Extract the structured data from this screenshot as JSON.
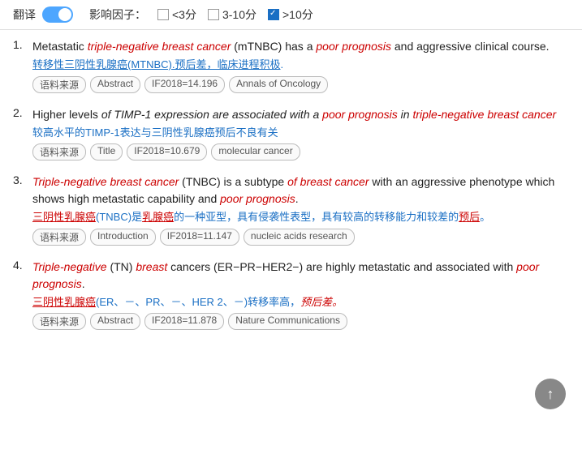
{
  "toolbar": {
    "translate_label": "翻译",
    "impact_label": "影响因子：",
    "filter_low_label": "<3分",
    "filter_mid_label": "3-10分",
    "filter_high_label": ">10分",
    "filter_high_checked": true
  },
  "results": [
    {
      "id": 1,
      "en_parts": [
        {
          "text": "Metastatic ",
          "style": ""
        },
        {
          "text": "triple-negative breast cancer",
          "style": "italic-red"
        },
        {
          "text": " (mTNBC) has a ",
          "style": ""
        },
        {
          "text": "poor prognosis",
          "style": "italic-red"
        },
        {
          "text": " and aggressive clinical course.",
          "style": ""
        }
      ],
      "cn_parts": [
        {
          "text": "转移性三阴性乳腺癌",
          "style": "underline-blue"
        },
        {
          "text": "(MTNBC)",
          "style": "underline-blue"
        },
        {
          "text": ".",
          "style": ""
        },
        {
          "text": "预后差，",
          "style": "underline-blue"
        },
        {
          "text": "临床进程积极",
          "style": "underline-blue"
        },
        {
          "text": ".",
          "style": ""
        }
      ],
      "tags": [
        "语料来源",
        "Abstract",
        "IF2018=14.196",
        "Annals of Oncology"
      ]
    },
    {
      "id": 2,
      "en_parts": [
        {
          "text": "Higher levels ",
          "style": ""
        },
        {
          "text": "of TIMP-1 expression are associated with a",
          "style": "italic"
        },
        {
          "text": " ",
          "style": ""
        },
        {
          "text": "poor prognosis",
          "style": "italic-red"
        },
        {
          "text": " in ",
          "style": "italic"
        },
        {
          "text": "triple-n",
          "style": "italic-red"
        },
        {
          "text": "egative breast cancer",
          "style": "italic-red"
        }
      ],
      "cn_parts": [
        {
          "text": "较高水平的TIMP-1表达与三阴性乳腺癌预后不良有关",
          "style": "blue"
        }
      ],
      "tags": [
        "语料来源",
        "Title",
        "IF2018=10.679",
        "molecular cancer"
      ]
    },
    {
      "id": 3,
      "en_parts": [
        {
          "text": "Triple-negative breast cancer",
          "style": "italic-red"
        },
        {
          "text": " (TNBC) is a subtype ",
          "style": ""
        },
        {
          "text": "of breast cancer",
          "style": "italic-red"
        },
        {
          "text": " with an aggressive phenotype which shows high metastatic capability and ",
          "style": ""
        },
        {
          "text": "poor prognosis",
          "style": "italic-red"
        },
        {
          "text": ".",
          "style": ""
        }
      ],
      "cn_parts": [
        {
          "text": "三阴性乳腺癌",
          "style": "underline-red"
        },
        {
          "text": "(TNBC)是",
          "style": ""
        },
        {
          "text": "乳腺癌",
          "style": "underline-red"
        },
        {
          "text": "的一种亚型，具有侵袭性表型，具有较高的转移能力和较差的",
          "style": ""
        },
        {
          "text": "预后",
          "style": "underline-red"
        },
        {
          "text": "。",
          "style": ""
        }
      ],
      "tags": [
        "语料来源",
        "Introduction",
        "IF2018=11.147",
        "nucleic acids research"
      ]
    },
    {
      "id": 4,
      "en_parts": [
        {
          "text": "Triple-negative",
          "style": "italic-red"
        },
        {
          "text": " (TN) ",
          "style": ""
        },
        {
          "text": "breast",
          "style": "italic-red"
        },
        {
          "text": " cancers (ER−PR−HER2−) are highly metastatic and associated with ",
          "style": ""
        },
        {
          "text": "poor prognosis",
          "style": "italic-red"
        },
        {
          "text": ".",
          "style": ""
        }
      ],
      "cn_parts": [
        {
          "text": "三阴性乳腺癌",
          "style": "underline-red"
        },
        {
          "text": "(ER、－、PR、－、HER 2、－)转移率高，",
          "style": ""
        },
        {
          "text": "预后差。",
          "style": "italic-red"
        }
      ],
      "tags": [
        "语料来源",
        "Abstract",
        "IF2018=11.878",
        "Nature Communications"
      ]
    }
  ],
  "scroll_top_icon": "↑"
}
